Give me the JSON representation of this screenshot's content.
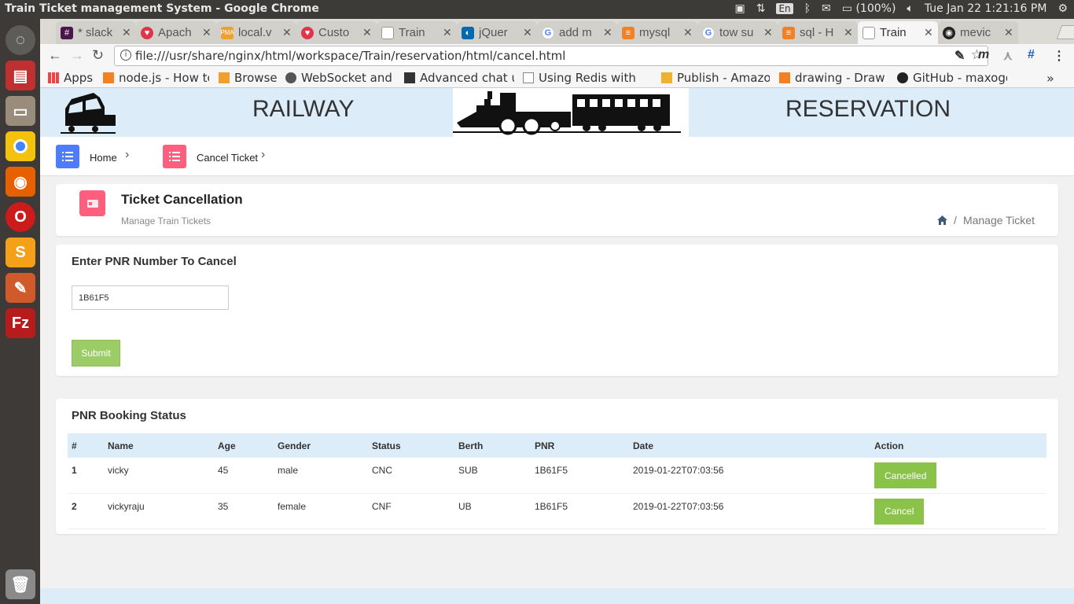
{
  "window": {
    "title": "Train Ticket management System - Google Chrome"
  },
  "tray": {
    "lang": "En",
    "battery": "(100%)",
    "datetime": "Tue Jan 22  1:21:16 PM"
  },
  "tabs": [
    {
      "label": "* slack",
      "color": "#4a154b"
    },
    {
      "label": "Apach",
      "color": "#e0344b"
    },
    {
      "label": "local.v",
      "color": "#f0a030"
    },
    {
      "label": "Custo",
      "color": "#e0344b"
    },
    {
      "label": "Train",
      "color": "#999999"
    },
    {
      "label": "jQuer",
      "color": "#0769ad"
    },
    {
      "label": "add m",
      "color": "#4285f4"
    },
    {
      "label": "mysql",
      "color": "#f48024"
    },
    {
      "label": "tow su",
      "color": "#4285f4"
    },
    {
      "label": "sql - H",
      "color": "#f48024"
    },
    {
      "label": "Train",
      "color": "#999999"
    },
    {
      "label": "mevic",
      "color": "#222222"
    }
  ],
  "address": {
    "url": "file:///usr/share/nginx/html/workspace/Train/reservation/html/cancel.html"
  },
  "bookmarks": [
    {
      "label": "Apps"
    },
    {
      "label": "node.js - How to"
    },
    {
      "label": "Browse"
    },
    {
      "label": "WebSocket and S"
    },
    {
      "label": "Advanced chat u"
    },
    {
      "label": "Using Redis with"
    },
    {
      "label": "Publish - Amazon"
    },
    {
      "label": "drawing - Draw in"
    },
    {
      "label": "GitHub - maxogd"
    }
  ],
  "banner": {
    "left": "RAILWAY",
    "right": "RESERVATION"
  },
  "crumbs": {
    "home": "Home",
    "cancel": "Cancel Ticket"
  },
  "page_header": {
    "title": "Ticket Cancellation",
    "subtitle": "Manage Train Tickets",
    "breadcrumb": "Manage Ticket"
  },
  "form": {
    "title": "Enter PNR Number To Cancel",
    "pnr_value": "1B61F5",
    "submit": "Submit"
  },
  "status": {
    "title": "PNR Booking Status",
    "headers": [
      "#",
      "Name",
      "Age",
      "Gender",
      "Status",
      "Berth",
      "PNR",
      "Date",
      "Action"
    ],
    "rows": [
      {
        "num": "1",
        "name": "vicky",
        "age": "45",
        "gender": "male",
        "status": "CNC",
        "berth": "SUB",
        "pnr": "1B61F5",
        "date": "2019-01-22T07:03:56",
        "action": "Cancelled"
      },
      {
        "num": "2",
        "name": "vickyraju",
        "age": "35",
        "gender": "female",
        "status": "CNF",
        "berth": "UB",
        "pnr": "1B61F5",
        "date": "2019-01-22T07:03:56",
        "action": "Cancel"
      }
    ]
  }
}
